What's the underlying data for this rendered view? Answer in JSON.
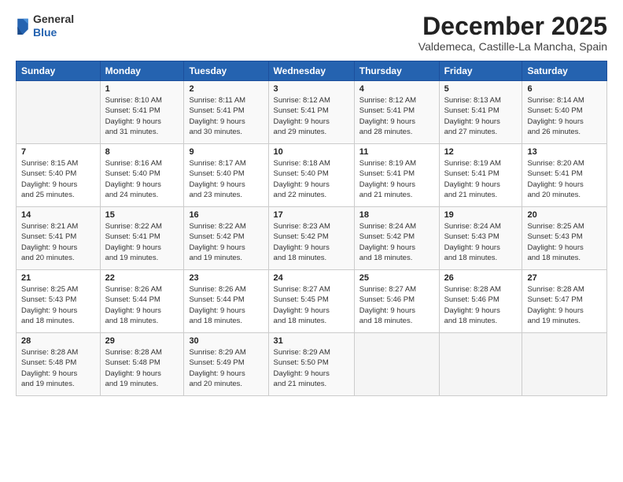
{
  "header": {
    "logo_general": "General",
    "logo_blue": "Blue",
    "month_title": "December 2025",
    "location": "Valdemeca, Castille-La Mancha, Spain"
  },
  "days_of_week": [
    "Sunday",
    "Monday",
    "Tuesday",
    "Wednesday",
    "Thursday",
    "Friday",
    "Saturday"
  ],
  "weeks": [
    [
      {
        "day": "",
        "info": ""
      },
      {
        "day": "1",
        "info": "Sunrise: 8:10 AM\nSunset: 5:41 PM\nDaylight: 9 hours\nand 31 minutes."
      },
      {
        "day": "2",
        "info": "Sunrise: 8:11 AM\nSunset: 5:41 PM\nDaylight: 9 hours\nand 30 minutes."
      },
      {
        "day": "3",
        "info": "Sunrise: 8:12 AM\nSunset: 5:41 PM\nDaylight: 9 hours\nand 29 minutes."
      },
      {
        "day": "4",
        "info": "Sunrise: 8:12 AM\nSunset: 5:41 PM\nDaylight: 9 hours\nand 28 minutes."
      },
      {
        "day": "5",
        "info": "Sunrise: 8:13 AM\nSunset: 5:41 PM\nDaylight: 9 hours\nand 27 minutes."
      },
      {
        "day": "6",
        "info": "Sunrise: 8:14 AM\nSunset: 5:40 PM\nDaylight: 9 hours\nand 26 minutes."
      }
    ],
    [
      {
        "day": "7",
        "info": "Sunrise: 8:15 AM\nSunset: 5:40 PM\nDaylight: 9 hours\nand 25 minutes."
      },
      {
        "day": "8",
        "info": "Sunrise: 8:16 AM\nSunset: 5:40 PM\nDaylight: 9 hours\nand 24 minutes."
      },
      {
        "day": "9",
        "info": "Sunrise: 8:17 AM\nSunset: 5:40 PM\nDaylight: 9 hours\nand 23 minutes."
      },
      {
        "day": "10",
        "info": "Sunrise: 8:18 AM\nSunset: 5:40 PM\nDaylight: 9 hours\nand 22 minutes."
      },
      {
        "day": "11",
        "info": "Sunrise: 8:19 AM\nSunset: 5:41 PM\nDaylight: 9 hours\nand 21 minutes."
      },
      {
        "day": "12",
        "info": "Sunrise: 8:19 AM\nSunset: 5:41 PM\nDaylight: 9 hours\nand 21 minutes."
      },
      {
        "day": "13",
        "info": "Sunrise: 8:20 AM\nSunset: 5:41 PM\nDaylight: 9 hours\nand 20 minutes."
      }
    ],
    [
      {
        "day": "14",
        "info": "Sunrise: 8:21 AM\nSunset: 5:41 PM\nDaylight: 9 hours\nand 20 minutes."
      },
      {
        "day": "15",
        "info": "Sunrise: 8:22 AM\nSunset: 5:41 PM\nDaylight: 9 hours\nand 19 minutes."
      },
      {
        "day": "16",
        "info": "Sunrise: 8:22 AM\nSunset: 5:42 PM\nDaylight: 9 hours\nand 19 minutes."
      },
      {
        "day": "17",
        "info": "Sunrise: 8:23 AM\nSunset: 5:42 PM\nDaylight: 9 hours\nand 18 minutes."
      },
      {
        "day": "18",
        "info": "Sunrise: 8:24 AM\nSunset: 5:42 PM\nDaylight: 9 hours\nand 18 minutes."
      },
      {
        "day": "19",
        "info": "Sunrise: 8:24 AM\nSunset: 5:43 PM\nDaylight: 9 hours\nand 18 minutes."
      },
      {
        "day": "20",
        "info": "Sunrise: 8:25 AM\nSunset: 5:43 PM\nDaylight: 9 hours\nand 18 minutes."
      }
    ],
    [
      {
        "day": "21",
        "info": "Sunrise: 8:25 AM\nSunset: 5:43 PM\nDaylight: 9 hours\nand 18 minutes."
      },
      {
        "day": "22",
        "info": "Sunrise: 8:26 AM\nSunset: 5:44 PM\nDaylight: 9 hours\nand 18 minutes."
      },
      {
        "day": "23",
        "info": "Sunrise: 8:26 AM\nSunset: 5:44 PM\nDaylight: 9 hours\nand 18 minutes."
      },
      {
        "day": "24",
        "info": "Sunrise: 8:27 AM\nSunset: 5:45 PM\nDaylight: 9 hours\nand 18 minutes."
      },
      {
        "day": "25",
        "info": "Sunrise: 8:27 AM\nSunset: 5:46 PM\nDaylight: 9 hours\nand 18 minutes."
      },
      {
        "day": "26",
        "info": "Sunrise: 8:28 AM\nSunset: 5:46 PM\nDaylight: 9 hours\nand 18 minutes."
      },
      {
        "day": "27",
        "info": "Sunrise: 8:28 AM\nSunset: 5:47 PM\nDaylight: 9 hours\nand 19 minutes."
      }
    ],
    [
      {
        "day": "28",
        "info": "Sunrise: 8:28 AM\nSunset: 5:48 PM\nDaylight: 9 hours\nand 19 minutes."
      },
      {
        "day": "29",
        "info": "Sunrise: 8:28 AM\nSunset: 5:48 PM\nDaylight: 9 hours\nand 19 minutes."
      },
      {
        "day": "30",
        "info": "Sunrise: 8:29 AM\nSunset: 5:49 PM\nDaylight: 9 hours\nand 20 minutes."
      },
      {
        "day": "31",
        "info": "Sunrise: 8:29 AM\nSunset: 5:50 PM\nDaylight: 9 hours\nand 21 minutes."
      },
      {
        "day": "",
        "info": ""
      },
      {
        "day": "",
        "info": ""
      },
      {
        "day": "",
        "info": ""
      }
    ]
  ]
}
